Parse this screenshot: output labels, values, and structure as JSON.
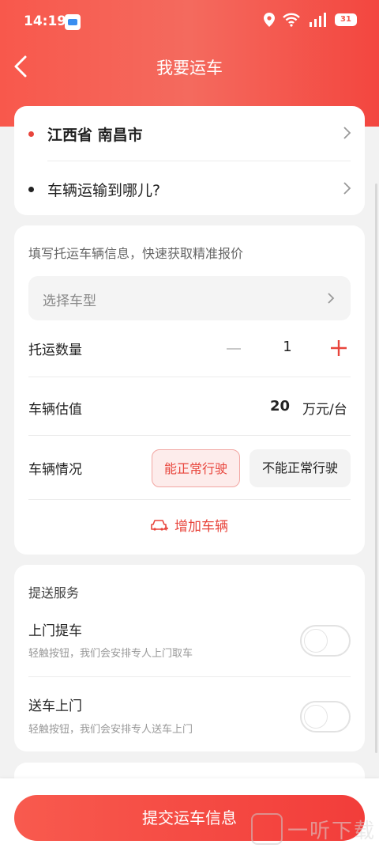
{
  "status_bar": {
    "time": "14:19",
    "battery": "31"
  },
  "header": {
    "title": "我要运车"
  },
  "route": {
    "origin": "江西省 南昌市",
    "destination_placeholder": "车辆运输到哪儿?"
  },
  "vehicle_info": {
    "hint": "填写托运车辆信息，快速获取精准报价",
    "vehicle_type_placeholder": "选择车型",
    "quantity_label": "托运数量",
    "quantity": "1",
    "value_label": "车辆估值",
    "value": "20",
    "value_unit": "万元/台",
    "condition_label": "车辆情况",
    "condition_options": [
      "能正常行驶",
      "不能正常行驶"
    ],
    "add_vehicle_label": "增加车辆"
  },
  "services": {
    "title": "提送服务",
    "items": [
      {
        "name": "上门提车",
        "desc": "轻触按钮，我们会安排专人上门取车"
      },
      {
        "name": "送车上门",
        "desc": "轻触按钮，我们会安排专人送车上门"
      }
    ]
  },
  "footer": {
    "submit_label": "提交运车信息"
  },
  "watermark": {
    "text": "一听下载"
  },
  "colors": {
    "accent": "#f3453e",
    "header_bg": "#f8584c"
  }
}
